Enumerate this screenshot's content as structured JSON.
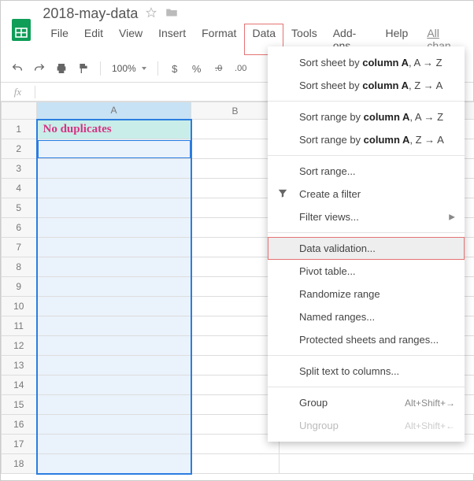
{
  "doc_title": "2018-may-data",
  "menubar": {
    "file": "File",
    "edit": "Edit",
    "view": "View",
    "insert": "Insert",
    "format": "Format",
    "data": "Data",
    "tools": "Tools",
    "addons": "Add-ons",
    "help": "Help",
    "allchanges": "All chan"
  },
  "toolbar": {
    "zoom": "100%",
    "currency": "$",
    "percent": "%",
    "dec0": ".0",
    "dec00": ".00"
  },
  "fx_label": "fx",
  "fx_value": "",
  "columns": {
    "A": "A",
    "B": "B"
  },
  "rows": [
    "1",
    "2",
    "3",
    "4",
    "5",
    "6",
    "7",
    "8",
    "9",
    "10",
    "11",
    "12",
    "13",
    "14",
    "15",
    "16",
    "17",
    "18"
  ],
  "cells": {
    "A1": "No duplicates"
  },
  "menu": {
    "sort_sheet_az_pre": "Sort sheet by ",
    "sort_sheet_az_bold": "column A",
    "sort_sheet_az_suf": ", A → Z",
    "sort_sheet_za_pre": "Sort sheet by ",
    "sort_sheet_za_bold": "column A",
    "sort_sheet_za_suf": ", Z → A",
    "sort_range_az_pre": "Sort range by ",
    "sort_range_az_bold": "column A",
    "sort_range_az_suf": ", A → Z",
    "sort_range_za_pre": "Sort range by ",
    "sort_range_za_bold": "column A",
    "sort_range_za_suf": ", Z → A",
    "sort_range": "Sort range...",
    "create_filter": "Create a filter",
    "filter_views": "Filter views...",
    "data_validation": "Data validation...",
    "pivot_table": "Pivot table...",
    "randomize": "Randomize range",
    "named_ranges": "Named ranges...",
    "protected": "Protected sheets and ranges...",
    "split_text": "Split text to columns...",
    "group": "Group",
    "group_sc": "Alt+Shift+→",
    "ungroup": "Ungroup",
    "ungroup_sc": "Alt+Shift+←"
  }
}
